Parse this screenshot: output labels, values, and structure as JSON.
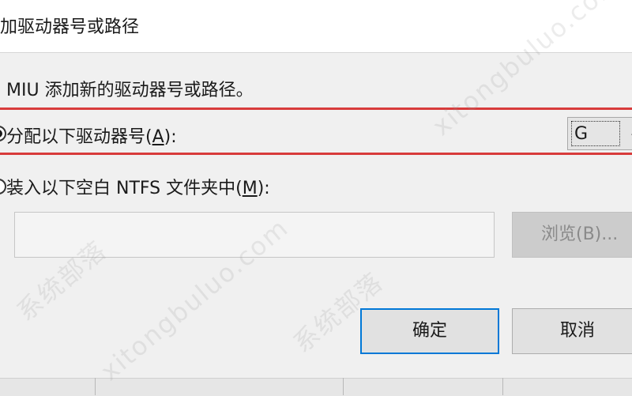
{
  "window": {
    "title": "加驱动器号或路径"
  },
  "dialog": {
    "description": "MIU 添加新的驱动器号或路径。",
    "assign_option": {
      "label_prefix": "分配以下驱动器号(",
      "label_access_key": "A",
      "label_suffix": "):",
      "selected": true,
      "drive_letter": "G"
    },
    "mount_option": {
      "label_prefix": "装入以下空白 NTFS 文件夹中(",
      "label_access_key": "M",
      "label_suffix": "):",
      "selected": false,
      "path_value": ""
    },
    "browse_label": "浏览(B)...",
    "ok_label": "确定",
    "cancel_label": "取消"
  },
  "watermark": {
    "text_cn": "系统部落",
    "text_latin": "xitongbuluo.com"
  },
  "colors": {
    "highlight_border": "#d83b3b",
    "focus_border": "#0078d7",
    "dialog_bg": "#f0f0f0"
  }
}
